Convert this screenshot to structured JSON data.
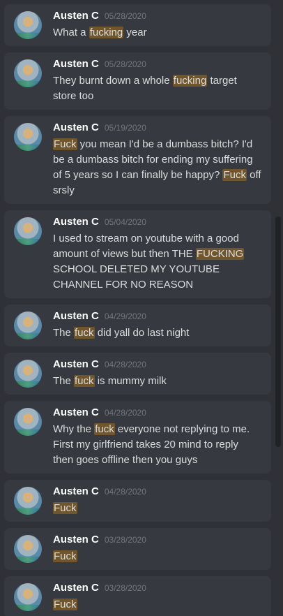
{
  "results": [
    {
      "author": "Austen C",
      "timestamp": "05/28/2020",
      "segments": [
        {
          "text": "What a "
        },
        {
          "text": "fucking",
          "highlight": true
        },
        {
          "text": " year"
        }
      ]
    },
    {
      "author": "Austen C",
      "timestamp": "05/28/2020",
      "segments": [
        {
          "text": "They burnt down a whole "
        },
        {
          "text": "fucking",
          "highlight": true
        },
        {
          "text": " target store too"
        }
      ]
    },
    {
      "author": "Austen C",
      "timestamp": "05/19/2020",
      "segments": [
        {
          "text": "Fuck",
          "highlight": true
        },
        {
          "text": " you mean I'd be a dumbass bitch? I'd be a dumbass bitch for ending my suffering of 5 years so I can finally be happy? "
        },
        {
          "text": "Fuck",
          "highlight": true
        },
        {
          "text": " off srsly"
        }
      ]
    },
    {
      "author": "Austen C",
      "timestamp": "05/04/2020",
      "segments": [
        {
          "text": "I used to stream on youtube with a good amount of views but then THE "
        },
        {
          "text": "FUCKING",
          "highlight": true
        },
        {
          "text": " SCHOOL DELETED MY YOUTUBE CHANNEL FOR NO REASON"
        }
      ]
    },
    {
      "author": "Austen C",
      "timestamp": "04/29/2020",
      "segments": [
        {
          "text": "The "
        },
        {
          "text": "fuck",
          "highlight": true
        },
        {
          "text": " did yall do last night"
        }
      ]
    },
    {
      "author": "Austen C",
      "timestamp": "04/28/2020",
      "segments": [
        {
          "text": "The "
        },
        {
          "text": "fuck",
          "highlight": true
        },
        {
          "text": " is mummy milk"
        }
      ]
    },
    {
      "author": "Austen C",
      "timestamp": "04/28/2020",
      "segments": [
        {
          "text": "Why the "
        },
        {
          "text": "fuck",
          "highlight": true
        },
        {
          "text": " everyone not replying to me. First my girlfriend takes 20 mind to reply then goes offline then you guys"
        }
      ]
    },
    {
      "author": "Austen C",
      "timestamp": "04/28/2020",
      "segments": [
        {
          "text": "Fuck",
          "highlight": true
        }
      ]
    },
    {
      "author": "Austen C",
      "timestamp": "03/28/2020",
      "segments": [
        {
          "text": "Fuck",
          "highlight": true
        }
      ]
    },
    {
      "author": "Austen C",
      "timestamp": "03/28/2020",
      "segments": [
        {
          "text": "Fuck",
          "highlight": true
        }
      ]
    }
  ],
  "colors": {
    "background": "#2f3136",
    "card": "#36393f",
    "author": "#ffffff",
    "timestamp": "#72767d",
    "text": "#dcddde",
    "highlight": "#70562a"
  }
}
